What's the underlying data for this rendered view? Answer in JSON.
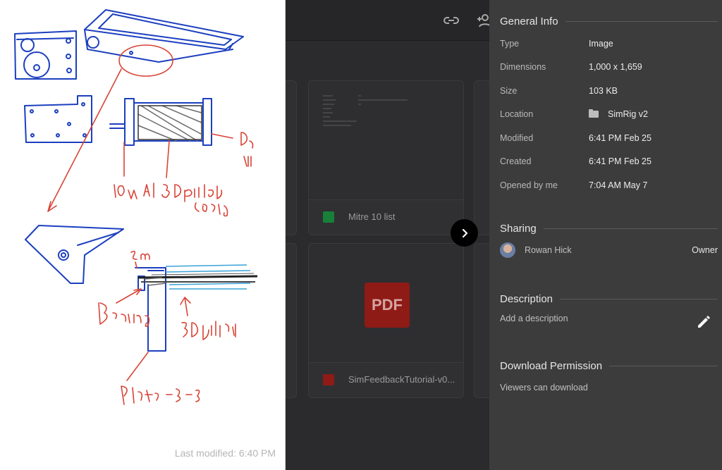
{
  "preview": {
    "last_modified": "Last modified: 6:40 PM"
  },
  "background_files": [
    {
      "title": "Mitre 10 list",
      "icon": "sheets-icon",
      "color": "#188038"
    },
    {
      "title": "SimFeedbackTutorial-v0...",
      "icon": "pdf-icon",
      "color": "#c5221f"
    }
  ],
  "pdf_thumb_label": "PDF",
  "panel": {
    "general_info": {
      "title": "General Info",
      "rows": [
        {
          "key": "Type",
          "value": "Image"
        },
        {
          "key": "Dimensions",
          "value": "1,000 x 1,659"
        },
        {
          "key": "Size",
          "value": "103 KB"
        },
        {
          "key": "Location",
          "value": "SimRig v2",
          "icon": "folder-icon"
        },
        {
          "key": "Modified",
          "value": "6:41 PM Feb 25"
        },
        {
          "key": "Created",
          "value": "6:41 PM Feb 25"
        },
        {
          "key": "Opened by me",
          "value": "7:04 AM May 7"
        }
      ]
    },
    "sharing": {
      "title": "Sharing",
      "user": "Rowan Hick",
      "role": "Owner"
    },
    "description": {
      "title": "Description",
      "placeholder": "Add a description"
    },
    "download_permission": {
      "title": "Download Permission",
      "value": "Viewers can download"
    }
  }
}
